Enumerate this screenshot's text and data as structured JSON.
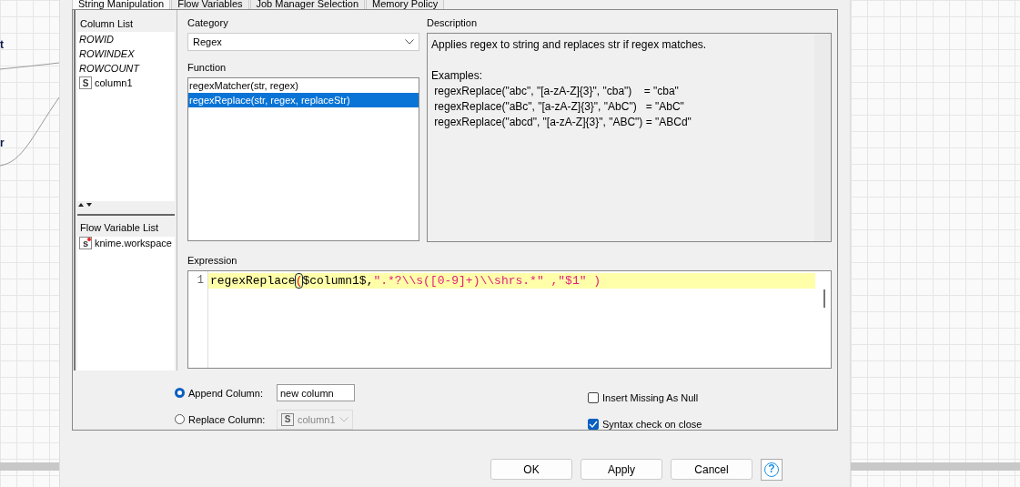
{
  "canvas": {
    "node_labels": [
      "t",
      "r"
    ]
  },
  "tabs": [
    {
      "label": "String Manipulation",
      "selected": true
    },
    {
      "label": "Flow Variables",
      "selected": false
    },
    {
      "label": "Job Manager Selection",
      "selected": false
    },
    {
      "label": "Memory Policy",
      "selected": false
    }
  ],
  "column_list": {
    "title": "Column List",
    "items": [
      {
        "name": "ROWID",
        "kind": "special"
      },
      {
        "name": "ROWINDEX",
        "kind": "special"
      },
      {
        "name": "ROWCOUNT",
        "kind": "special"
      },
      {
        "name": "column1",
        "kind": "string",
        "type_label": "S"
      }
    ]
  },
  "flow_variable_list": {
    "title": "Flow Variable List",
    "items": [
      {
        "name": "knime.workspace",
        "kind": "string",
        "type_label": "s"
      }
    ]
  },
  "category": {
    "label": "Category",
    "value": "Regex"
  },
  "function": {
    "label": "Function",
    "items": [
      {
        "text": "regexMatcher(str, regex)",
        "selected": false
      },
      {
        "text": "regexReplace(str, regex, replaceStr)",
        "selected": true
      }
    ]
  },
  "description": {
    "label": "Description",
    "summary": "Applies regex to string and replaces str if regex matches.",
    "examples_title": "Examples:",
    "examples": [
      " regexReplace(\"abc\", \"[a-zA-Z]{3}\", \"cba\")    = \"cba\"",
      " regexReplace(\"aBc\", \"[a-zA-Z]{3}\", \"AbC\")   = \"AbC\"",
      " regexReplace(\"abcd\", \"[a-zA-Z]{3}\", \"ABC\") = \"ABCd\""
    ]
  },
  "expression": {
    "label": "Expression",
    "line_number": "1",
    "tokens": [
      {
        "text": "regexReplace",
        "kind": "plain"
      },
      {
        "text": "(",
        "kind": "bracket"
      },
      {
        "text": "$column1$,",
        "kind": "plain"
      },
      {
        "text": "\".*?\\\\s([0-9]+)\\\\shrs.*\" ,\"$1\" )",
        "kind": "string"
      }
    ]
  },
  "output": [
    {
      "label": "Append Column:",
      "selected": true,
      "kind": "text",
      "value": "new column"
    },
    {
      "label": "Replace Column:",
      "selected": false,
      "kind": "select",
      "value": "column1",
      "type_label": "S"
    }
  ],
  "options": [
    {
      "label": "Insert Missing As Null",
      "checked": false
    },
    {
      "label": "Syntax check on close",
      "checked": true
    }
  ],
  "buttons": [
    "OK",
    "Apply",
    "Cancel"
  ],
  "help": "?"
}
